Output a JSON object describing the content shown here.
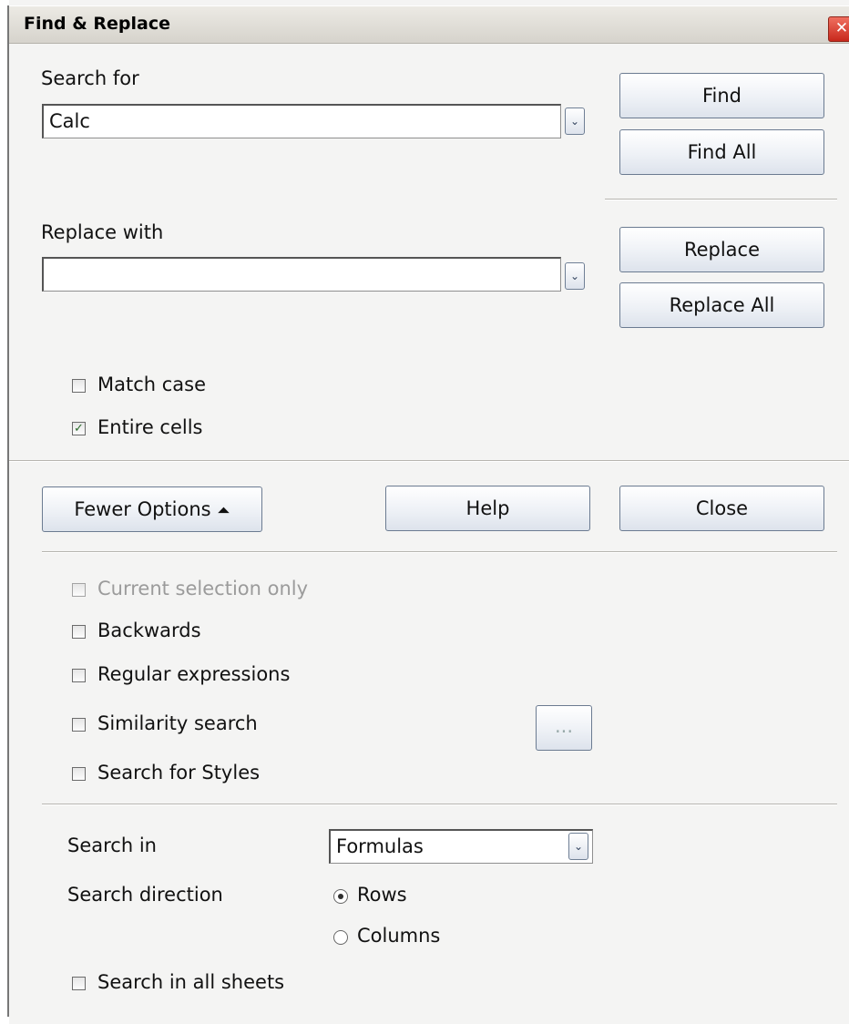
{
  "window": {
    "title": "Find & Replace",
    "close_glyph": "✕"
  },
  "search": {
    "label": "Search for",
    "value": "Calc",
    "dropdown_glyph": "⌄"
  },
  "replace": {
    "label": "Replace with",
    "value": "",
    "dropdown_glyph": "⌄"
  },
  "buttons": {
    "find": "Find",
    "find_all": "Find All",
    "replace": "Replace",
    "replace_all": "Replace All",
    "fewer_options": "Fewer Options",
    "fewer_options_glyph": "⏶",
    "help": "Help",
    "close": "Close",
    "similarity_more": "..."
  },
  "options": {
    "match_case": {
      "label": "Match case",
      "checked": false
    },
    "entire_cells": {
      "label": "Entire cells",
      "checked": true,
      "mark": "✓"
    }
  },
  "more_options": {
    "current_selection_only": {
      "label": "Current selection only",
      "checked": false,
      "enabled": false
    },
    "backwards": {
      "label": "Backwards",
      "checked": false
    },
    "regular_expressions": {
      "label": "Regular expressions",
      "checked": false
    },
    "similarity_search": {
      "label": "Similarity search",
      "checked": false
    },
    "search_for_styles": {
      "label": "Search for Styles",
      "checked": false
    }
  },
  "search_in": {
    "label": "Search in",
    "value": "Formulas",
    "dropdown_glyph": "⌄"
  },
  "search_direction": {
    "label": "Search direction",
    "options": [
      {
        "label": "Rows",
        "selected": true
      },
      {
        "label": "Columns",
        "selected": false
      }
    ]
  },
  "all_sheets": {
    "label": "Search in all sheets",
    "checked": false
  },
  "colors": {
    "titlebar_close": "#d83a2a",
    "dialog_bg": "#f4f4f3",
    "button_border": "#6b7b91"
  }
}
